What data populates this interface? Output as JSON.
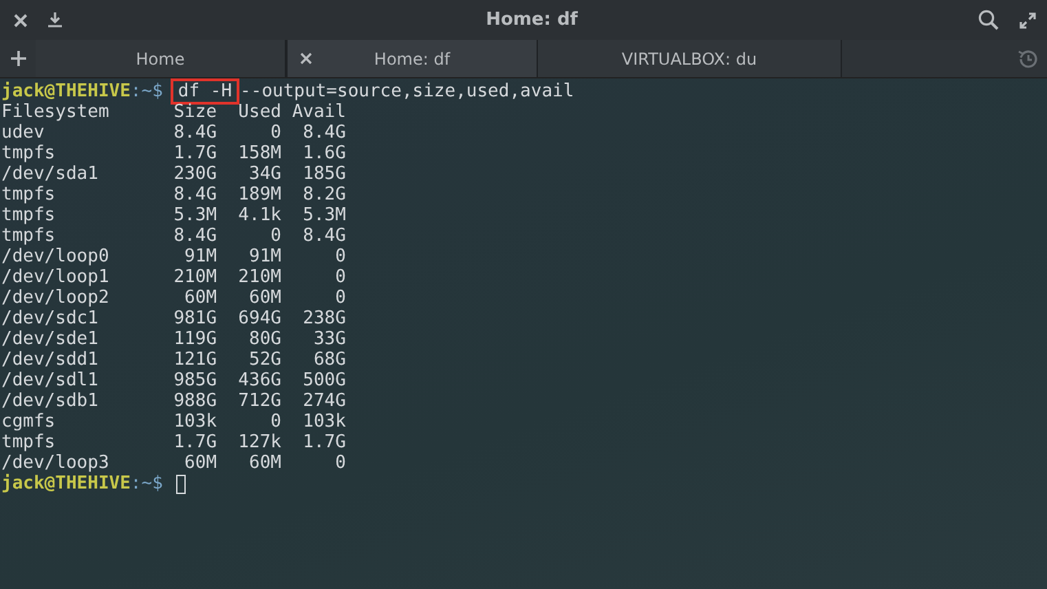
{
  "window": {
    "title": "Home: df"
  },
  "tabs": [
    {
      "label": "Home",
      "selected": false
    },
    {
      "label": "Home: df",
      "selected": true
    },
    {
      "label": "VIRTUALBOX: du",
      "selected": false
    }
  ],
  "terminal": {
    "lines": [
      {
        "kind": "prompt",
        "user": "jack@THEHIVE",
        "path": ":~$",
        "command": "df -H",
        "highlighted": true,
        "args": "--output=source,size,used,avail"
      },
      {
        "kind": "output",
        "text": "Filesystem      Size  Used Avail"
      },
      {
        "kind": "output",
        "text": "udev            8.4G     0  8.4G"
      },
      {
        "kind": "output",
        "text": "tmpfs           1.7G  158M  1.6G"
      },
      {
        "kind": "output",
        "text": "/dev/sda1       230G   34G  185G"
      },
      {
        "kind": "output",
        "text": "tmpfs           8.4G  189M  8.2G"
      },
      {
        "kind": "output",
        "text": "tmpfs           5.3M  4.1k  5.3M"
      },
      {
        "kind": "output",
        "text": "tmpfs           8.4G     0  8.4G"
      },
      {
        "kind": "output",
        "text": "/dev/loop0       91M   91M     0"
      },
      {
        "kind": "output",
        "text": "/dev/loop1      210M  210M     0"
      },
      {
        "kind": "output",
        "text": "/dev/loop2       60M   60M     0"
      },
      {
        "kind": "output",
        "text": "/dev/sdc1       981G  694G  238G"
      },
      {
        "kind": "output",
        "text": "/dev/sde1       119G   80G   33G"
      },
      {
        "kind": "output",
        "text": "/dev/sdd1       121G   52G   68G"
      },
      {
        "kind": "output",
        "text": "/dev/sdl1       985G  436G  500G"
      },
      {
        "kind": "output",
        "text": "/dev/sdb1       988G  712G  274G"
      },
      {
        "kind": "output",
        "text": "cgmfs           103k     0  103k"
      },
      {
        "kind": "output",
        "text": "tmpfs           1.7G  127k  1.7G"
      },
      {
        "kind": "output",
        "text": "/dev/loop3       60M   60M     0"
      },
      {
        "kind": "prompt",
        "user": "jack@THEHIVE",
        "path": ":~$",
        "cursor": true
      }
    ]
  }
}
